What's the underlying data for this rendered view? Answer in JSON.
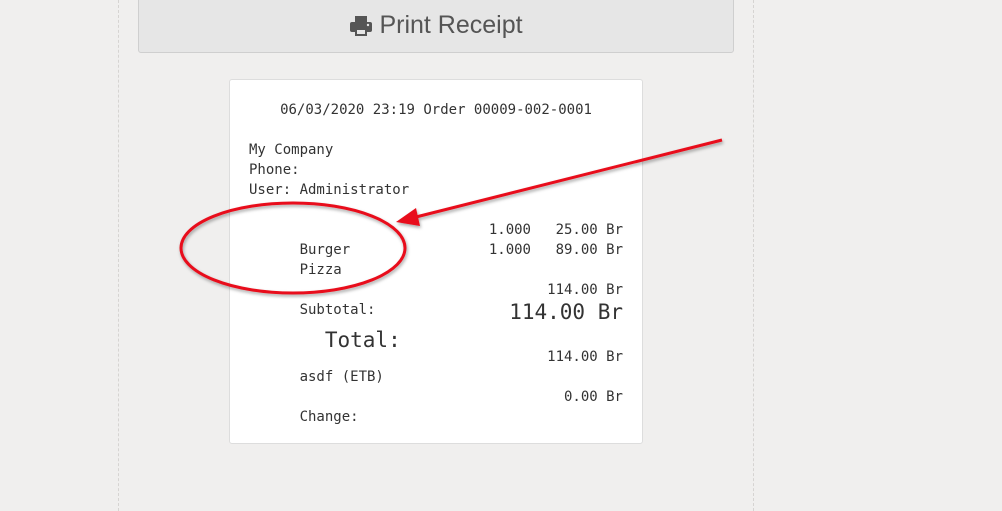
{
  "print_button": {
    "label": "Print Receipt",
    "icon": "print-icon"
  },
  "receipt": {
    "header": "06/03/2020 23:19 Order 00009-002-0001",
    "company": "My Company",
    "phone": "Phone:",
    "user": "User: Administrator",
    "items": [
      {
        "name": "Burger",
        "qty": "1.000",
        "price": "25.00 Br"
      },
      {
        "name": "Pizza",
        "qty": "1.000",
        "price": "89.00 Br"
      }
    ],
    "subtotal_label": "Subtotal:",
    "subtotal_value": "114.00 Br",
    "total_label": "Total:",
    "total_value": "114.00 Br",
    "payment_label": "asdf (ETB)",
    "payment_value": "114.00 Br",
    "change_label": "Change:",
    "change_value": "0.00 Br"
  },
  "colors": {
    "background": "#f0efee",
    "annotation": "#e8101a"
  }
}
